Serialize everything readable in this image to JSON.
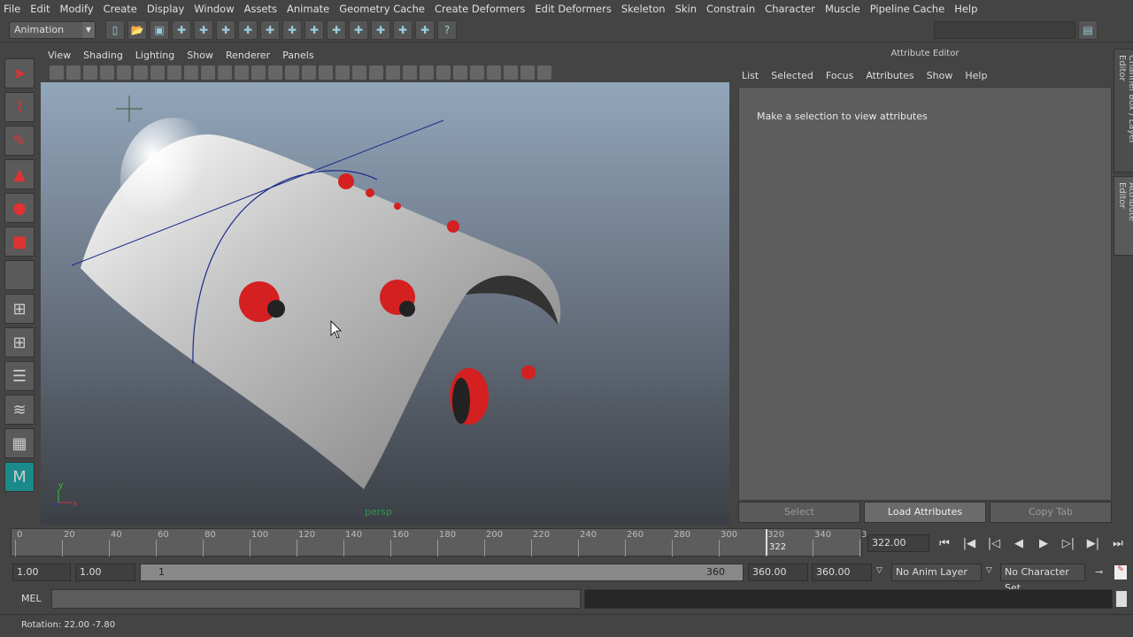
{
  "menubar": [
    "File",
    "Edit",
    "Modify",
    "Create",
    "Display",
    "Window",
    "Assets",
    "Animate",
    "Geometry Cache",
    "Create Deformers",
    "Edit Deformers",
    "Skeleton",
    "Skin",
    "Constrain",
    "Character",
    "Muscle",
    "Pipeline Cache",
    "Help"
  ],
  "statusbar": {
    "mode": "Animation",
    "icons": [
      "new-scene",
      "open-scene",
      "save-scene",
      "select-hierarchy",
      "select-object",
      "select-component",
      "snap-grid",
      "snap-curve",
      "snap-point",
      "snap-plane",
      "make-live",
      "history",
      "render",
      "ipr",
      "render-settings",
      "help"
    ]
  },
  "toolbox": [
    "select-tool",
    "lasso-tool",
    "paint-select-tool",
    "move-tool",
    "rotate-tool",
    "scale-tool",
    "last-tool",
    "single-perspective-layout",
    "four-view-layout",
    "outliner-layout",
    "graph-editor-layout",
    "dope-sheet-layout",
    "maya-logo"
  ],
  "viewport": {
    "menus": [
      "View",
      "Shading",
      "Lighting",
      "Show",
      "Renderer",
      "Panels"
    ],
    "camera_label": "persp",
    "axis_labels": [
      "y",
      "x",
      "z"
    ]
  },
  "attribute_editor": {
    "title": "Attribute Editor",
    "menus": [
      "List",
      "Selected",
      "Focus",
      "Attributes",
      "Show",
      "Help"
    ],
    "message": "Make a selection to view attributes",
    "buttons": [
      "Select",
      "Load Attributes",
      "Copy Tab"
    ]
  },
  "side_tabs": [
    "Channel Box / Layer Editor",
    "Attribute Editor"
  ],
  "timeline": {
    "ticks": [
      "0",
      "20",
      "40",
      "60",
      "80",
      "100",
      "120",
      "140",
      "160",
      "180",
      "200",
      "220",
      "240",
      "260",
      "280",
      "300",
      "320",
      "340",
      "3"
    ],
    "current_frame_marker": "322",
    "current_time": "322.00"
  },
  "range": {
    "start_time": "1.00",
    "playback_start": "1.00",
    "slider_start": "1",
    "slider_end": "360",
    "playback_end": "360.00",
    "end_time": "360.00",
    "anim_layer": "No Anim Layer",
    "character_set": "No Character Set"
  },
  "command_line": {
    "language": "MEL"
  },
  "help_line": "Rotation:  22.00    -7.80",
  "colors": {
    "ladybug": "#d42020",
    "viewport_top": "#92a6bb",
    "viewport_bottom": "#3b3f45"
  }
}
